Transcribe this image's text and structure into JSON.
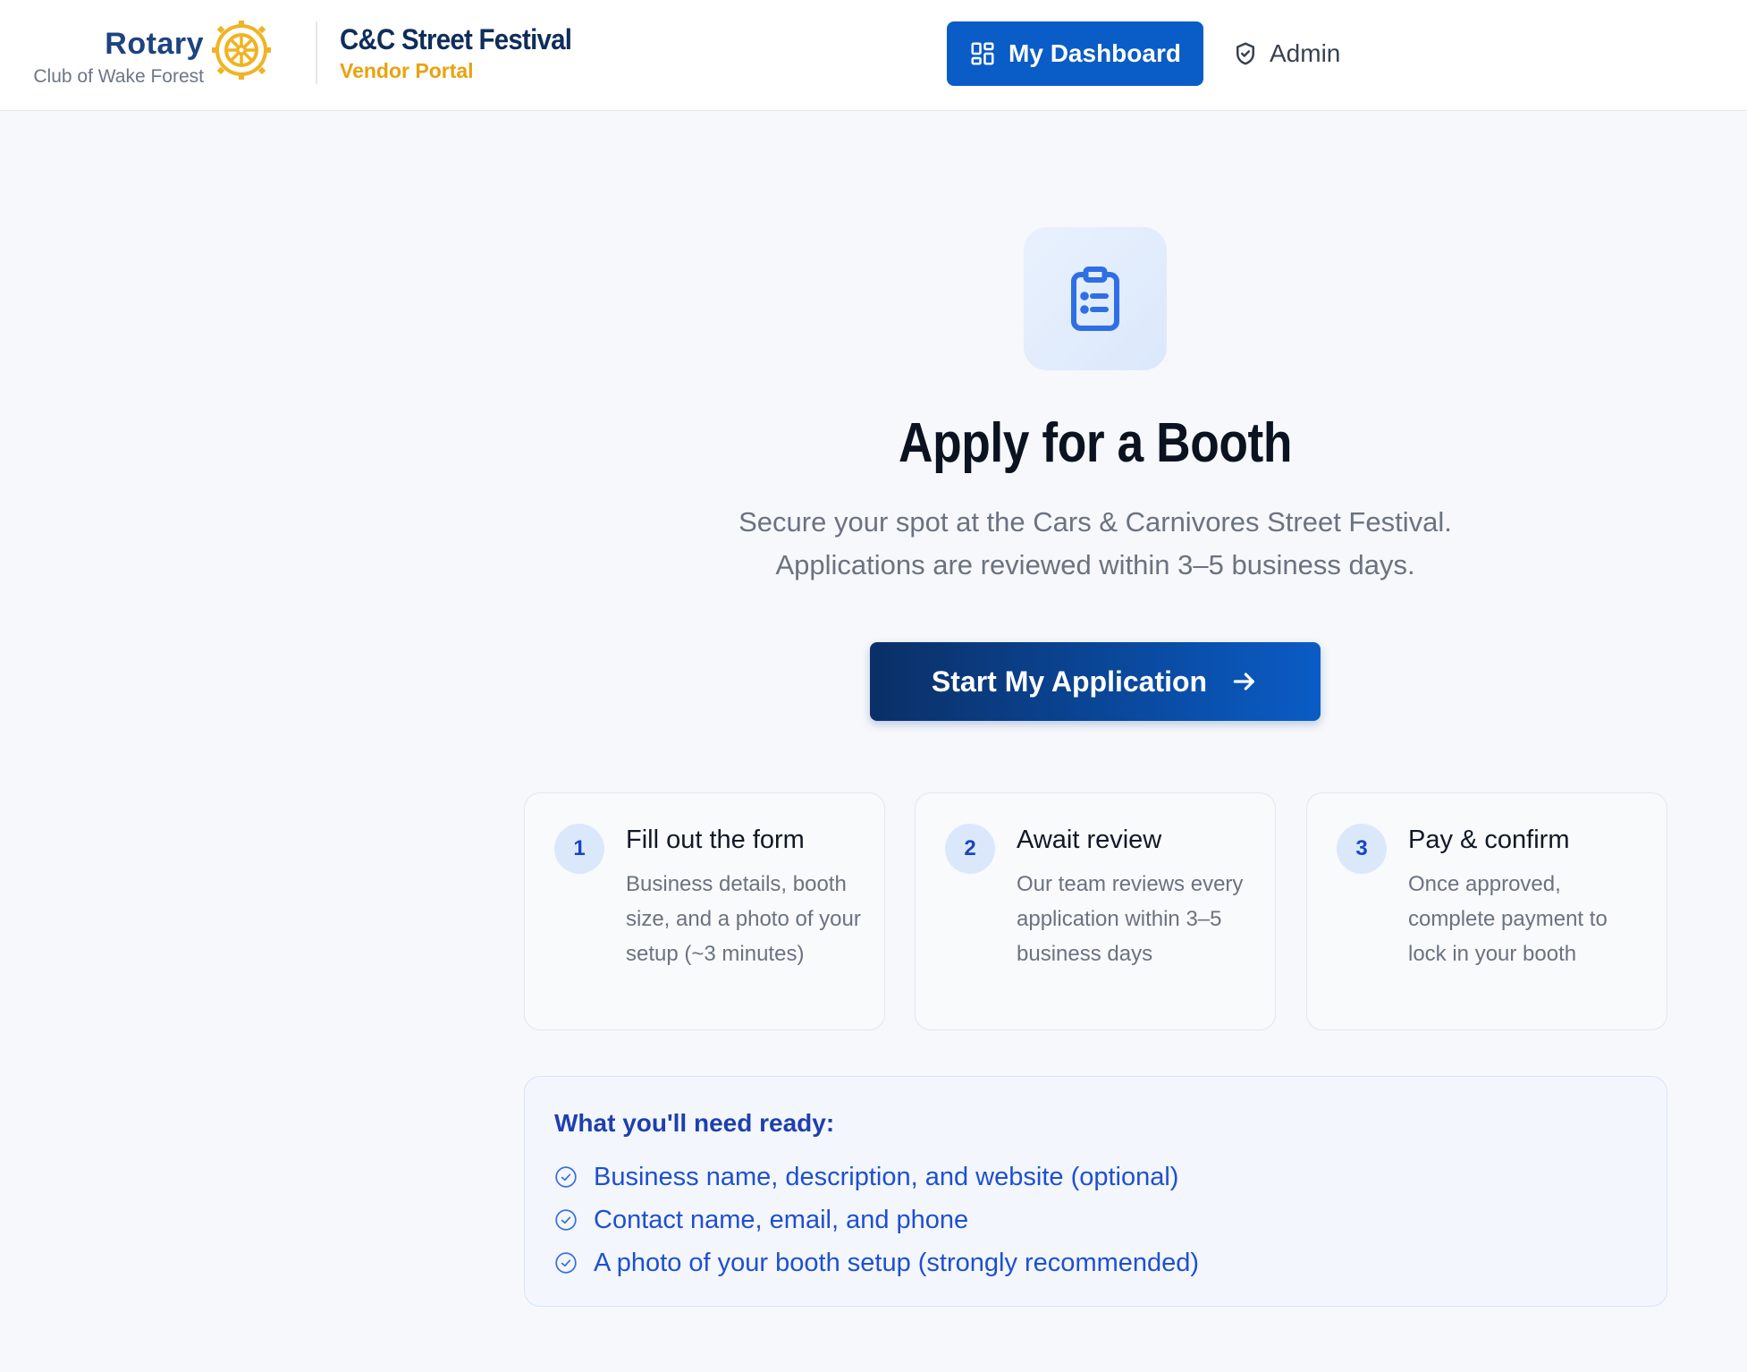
{
  "header": {
    "logo_rotary": "Rotary",
    "logo_club": "Club of Wake Forest",
    "brand_title": "C&C Street Festival",
    "brand_subtitle": "Vendor Portal",
    "dashboard_label": "My Dashboard",
    "admin_label": "Admin"
  },
  "hero": {
    "icon": "clipboard-list-icon",
    "title": "Apply for a Booth",
    "subtitle_line1": "Secure your spot at the Cars & Carnivores Street Festival.",
    "subtitle_line2": "Applications are reviewed within 3–5 business days.",
    "cta_label": "Start My Application"
  },
  "steps": [
    {
      "number": "1",
      "title": "Fill out the form",
      "description": "Business details, booth size, and a photo of your setup (~3 minutes)"
    },
    {
      "number": "2",
      "title": "Await review",
      "description": "Our team reviews every application within 3–5 business days"
    },
    {
      "number": "3",
      "title": "Pay & confirm",
      "description": "Once approved, complete payment to lock in your booth"
    }
  ],
  "needs": {
    "title": "What you'll need ready:",
    "items": [
      "Business name, description, and website (optional)",
      "Contact name, email, and phone",
      "A photo of your booth setup (strongly recommended)"
    ]
  },
  "colors": {
    "primary": "#0a5cc6",
    "navy": "#0b2f66",
    "accent_gold": "#e9a20f",
    "needs_text": "#1f4fd1"
  }
}
